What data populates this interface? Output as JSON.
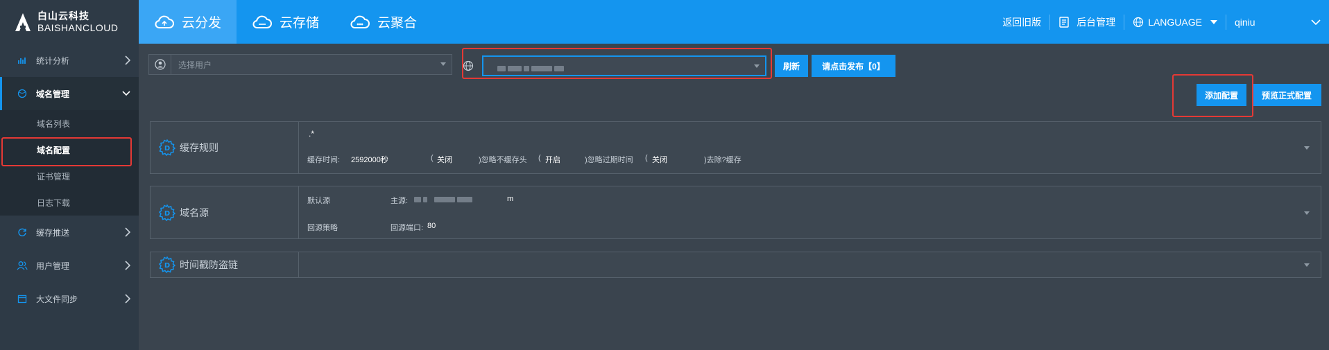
{
  "brand": {
    "name_cn": "白山云科技",
    "name_en": "BAISHANCLOUD"
  },
  "topnav": [
    {
      "label": "云分发",
      "icon": "cloud-up-icon",
      "active": true
    },
    {
      "label": "云存储",
      "icon": "cloud-icon",
      "active": false
    },
    {
      "label": "云聚合",
      "icon": "cloud-link-icon",
      "active": false
    }
  ],
  "topright": {
    "legacy": "返回旧版",
    "admin": "后台管理",
    "language": "LANGUAGE",
    "user": "qiniu"
  },
  "sidebar": {
    "items": [
      {
        "label": "统计分析",
        "icon": "bar-chart-icon"
      },
      {
        "label": "域名管理",
        "icon": "globe-icon"
      },
      {
        "label": "缓存推送",
        "icon": "refresh-icon"
      },
      {
        "label": "用户管理",
        "icon": "users-icon"
      },
      {
        "label": "大文件同步",
        "icon": "calendar-icon"
      }
    ],
    "sub": [
      "域名列表",
      "域名配置",
      "证书管理",
      "日志下载"
    ]
  },
  "toolbar": {
    "user_placeholder": "选择用户",
    "refresh": "刷新",
    "publish": "请点击发布【0】",
    "add_config": "添加配置",
    "preview_config": "预览正式配置"
  },
  "panels": {
    "cache": {
      "title": "缓存规则",
      "pattern": ".*",
      "time_label": "缓存时间:",
      "time_value": "2592000秒",
      "p1": "(",
      "v1": "关闭",
      "t1": ")忽略不缓存头",
      "p2": "(",
      "v2": "开启",
      "t2": ")忽略过期时间",
      "p3": "(",
      "v3": "关闭",
      "t3": ")去除?缓存"
    },
    "origin": {
      "title": "域名源",
      "default_src": "默认源",
      "main_src_label": "主源:",
      "main_src_tail": "m",
      "back_policy": "回源策略",
      "back_port_label": "回源端口:",
      "back_port": "80"
    },
    "hotlink": {
      "title": "时间戳防盗链"
    }
  }
}
